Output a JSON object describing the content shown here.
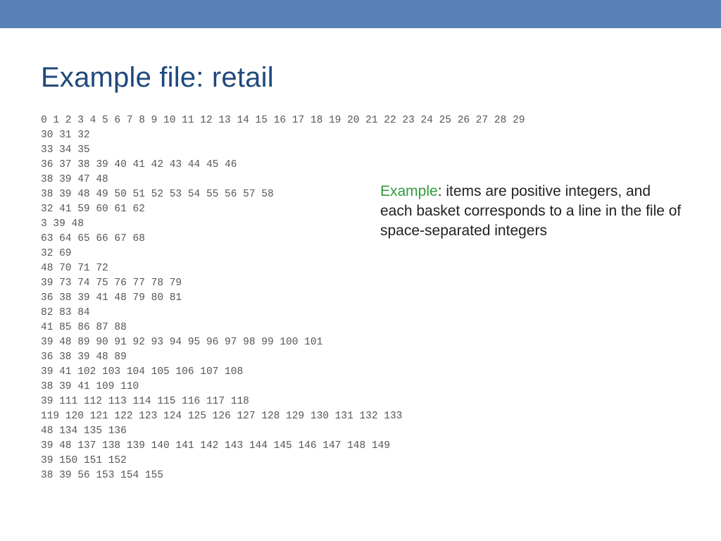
{
  "title": "Example file: retail",
  "file_lines": [
    "0 1 2 3 4 5 6 7 8 9 10 11 12 13 14 15 16 17 18 19 20 21 22 23 24 25 26 27 28 29",
    "30 31 32",
    "33 34 35",
    "36 37 38 39 40 41 42 43 44 45 46",
    "38 39 47 48",
    "38 39 48 49 50 51 52 53 54 55 56 57 58",
    "32 41 59 60 61 62",
    "3 39 48",
    "63 64 65 66 67 68",
    "32 69",
    "48 70 71 72",
    "39 73 74 75 76 77 78 79",
    "36 38 39 41 48 79 80 81",
    "82 83 84",
    "41 85 86 87 88",
    "39 48 89 90 91 92 93 94 95 96 97 98 99 100 101",
    "36 38 39 48 89",
    "39 41 102 103 104 105 106 107 108",
    "38 39 41 109 110",
    "39 111 112 113 114 115 116 117 118",
    "119 120 121 122 123 124 125 126 127 128 129 130 131 132 133",
    "48 134 135 136",
    "39 48 137 138 139 140 141 142 143 144 145 146 147 148 149",
    "39 150 151 152",
    "38 39 56 153 154 155"
  ],
  "caption": {
    "accent": "Example",
    "rest": ": items are positive integers, and each basket corresponds to a line in the file of space-separated integers"
  }
}
